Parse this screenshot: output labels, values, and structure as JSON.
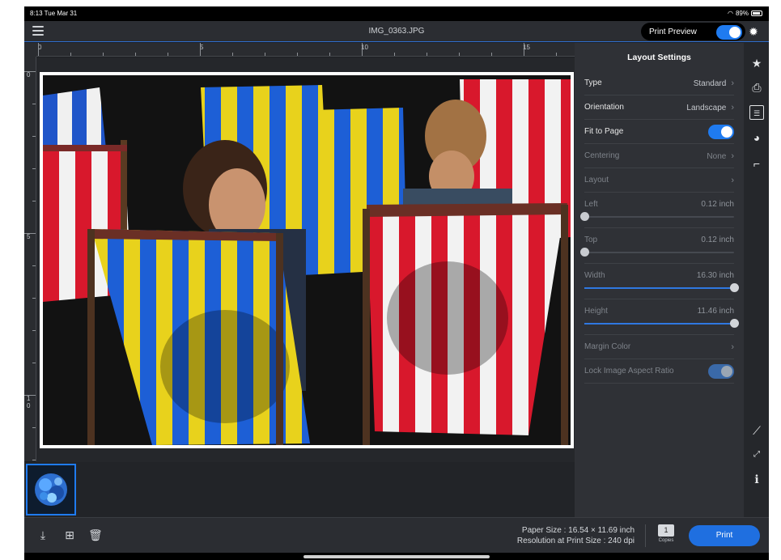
{
  "status_bar": {
    "time": "8:13  Tue Mar 31",
    "battery": "89%"
  },
  "header": {
    "file_name": "IMG_0363.JPG",
    "print_preview_label": "Print Preview",
    "print_preview_on": true
  },
  "ruler": {
    "top_marks": [
      "0",
      "5",
      "10",
      "15"
    ],
    "left_marks": [
      "0",
      "5",
      "1\n0"
    ]
  },
  "panel": {
    "title": "Layout Settings",
    "rows": [
      {
        "label": "Type",
        "value": "Standard",
        "kind": "nav",
        "enabled": true
      },
      {
        "label": "Orientation",
        "value": "Landscape",
        "kind": "nav",
        "enabled": true
      },
      {
        "label": "Fit to Page",
        "value": "",
        "kind": "toggle",
        "on": true,
        "enabled": true
      },
      {
        "label": "Centering",
        "value": "None",
        "kind": "nav",
        "enabled": false
      },
      {
        "label": "Layout",
        "value": "",
        "kind": "nav",
        "enabled": false
      }
    ],
    "sliders": [
      {
        "label": "Left",
        "value": "0.12 inch",
        "fraction": 0.0,
        "active": false
      },
      {
        "label": "Top",
        "value": "0.12 inch",
        "fraction": 0.0,
        "active": false
      },
      {
        "label": "Width",
        "value": "16.30 inch",
        "fraction": 1.0,
        "active": false
      },
      {
        "label": "Height",
        "value": "11.46 inch",
        "fraction": 1.0,
        "active": false
      }
    ],
    "margin_color_label": "Margin Color",
    "lock_aspect_label": "Lock Image Aspect Ratio",
    "lock_aspect_on": true
  },
  "rail_icons": [
    "star-icon",
    "printer-icon",
    "layout-icon",
    "color-palette-icon",
    "crop-icon",
    "ruler-icon",
    "fit-screen-icon",
    "info-icon"
  ],
  "bottom": {
    "paper_size": "Paper Size : 16.54 × 11.69 inch",
    "resolution": "Resolution at Print Size : 240 dpi",
    "copies_count": "1",
    "copies_label": "Copies",
    "print_label": "Print"
  },
  "colors": {
    "accent": "#1f7bf0",
    "panel": "#2f3136",
    "background": "#1d1f23"
  }
}
